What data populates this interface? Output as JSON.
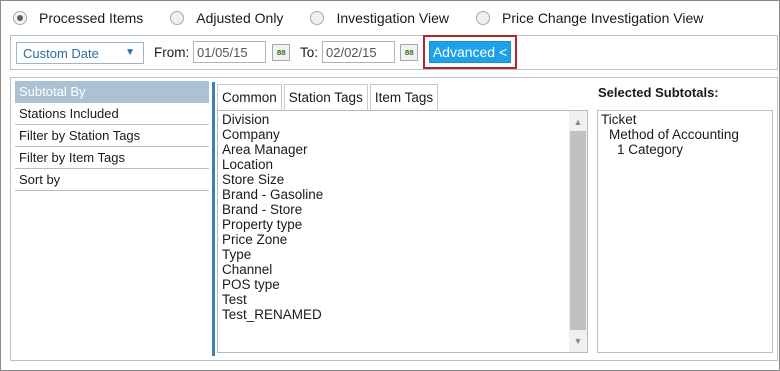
{
  "view_options": [
    {
      "label": "Processed Items",
      "checked": true
    },
    {
      "label": "Adjusted Only",
      "checked": false
    },
    {
      "label": "Investigation View",
      "checked": false
    },
    {
      "label": "Price Change Investigation View",
      "checked": false
    }
  ],
  "filter": {
    "date_range": "Custom Date",
    "from_label": "From:",
    "from_value": "01/05/15",
    "to_label": "To:",
    "to_value": "02/02/15",
    "calendar_icon_text": "88",
    "advanced_label": "Advanced <"
  },
  "sidebar": {
    "header": "Subtotal By",
    "items": [
      "Stations Included",
      "Filter by Station Tags",
      "Filter by Item Tags",
      "Sort by"
    ]
  },
  "tabs": [
    "Common",
    "Station Tags",
    "Item Tags"
  ],
  "station_tags": [
    "Division",
    "Company",
    "Area Manager",
    "Location",
    "Store Size",
    "Brand - Gasoline",
    "Brand - Store",
    "Property type",
    "Price Zone",
    "Type",
    "Channel",
    "POS type",
    "Test",
    "Test_RENAMED"
  ],
  "selected_subtotals": {
    "title": "Selected Subtotals:",
    "items": [
      "Ticket",
      "Method of Accounting",
      "1 Category"
    ]
  },
  "colors": {
    "accent": "#1da1ea",
    "highlight_border": "#b7232a",
    "sidebar_header": "#a9c2d6",
    "separator": "#3e7fae"
  }
}
